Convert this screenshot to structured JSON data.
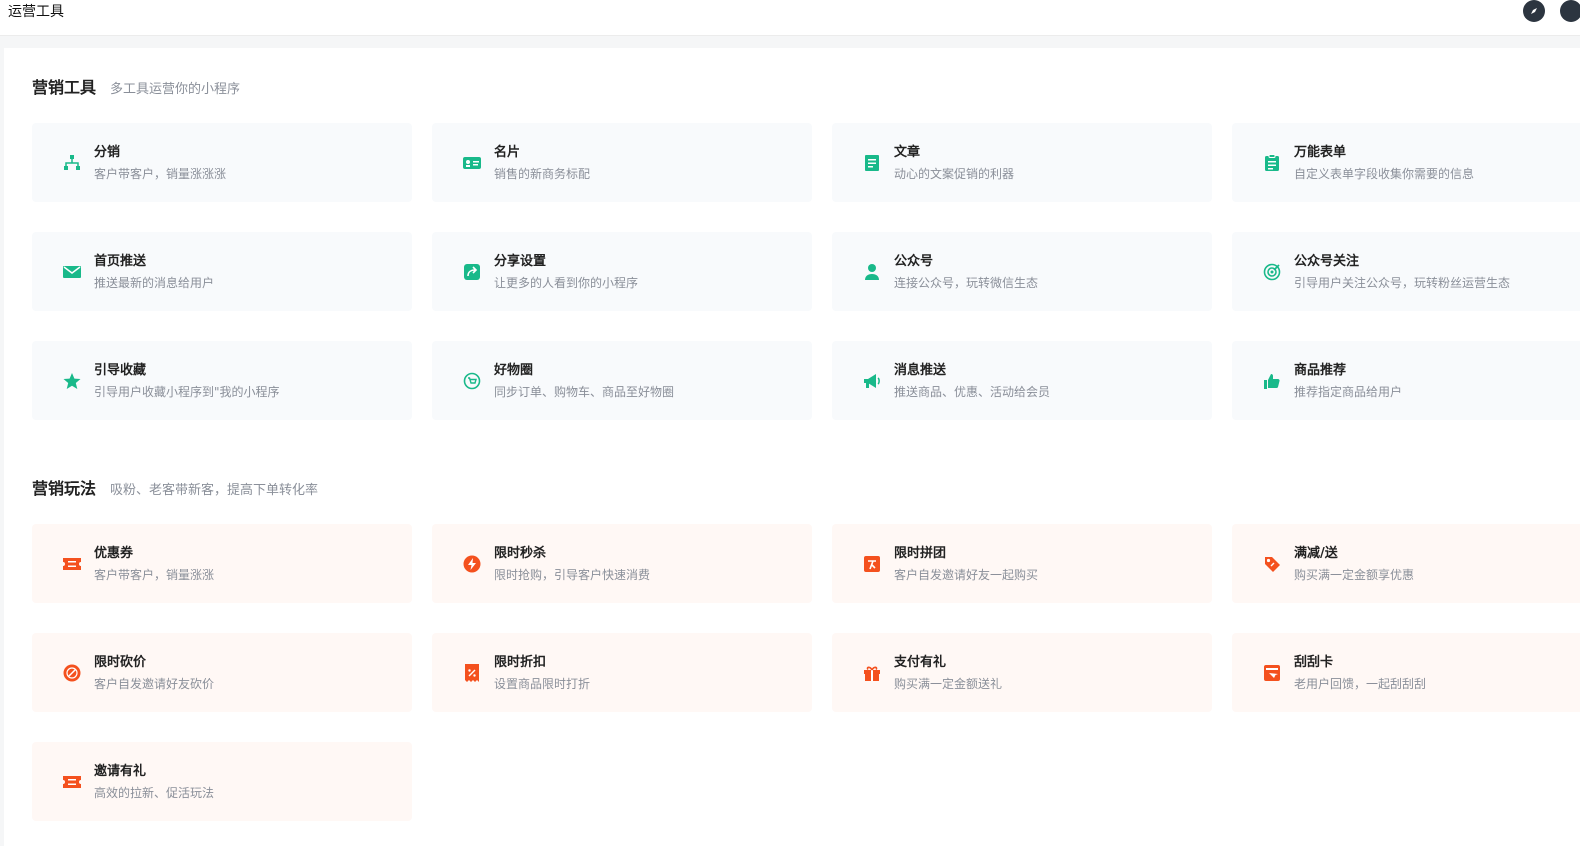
{
  "header": {
    "title": "运营工具"
  },
  "colors": {
    "green": "#19b98a",
    "orange": "#f4511e"
  },
  "tools": {
    "title": "营销工具",
    "subtitle": "多工具运营你的小程序",
    "items": [
      {
        "title": "分销",
        "desc": "客户带客户，销量涨涨涨",
        "icon": "org-chart-icon"
      },
      {
        "title": "名片",
        "desc": "销售的新商务标配",
        "icon": "id-card-icon"
      },
      {
        "title": "文章",
        "desc": "动心的文案促销的利器",
        "icon": "document-icon"
      },
      {
        "title": "万能表单",
        "desc": "自定义表单字段收集你需要的信息",
        "icon": "clipboard-icon"
      },
      {
        "title": "首页推送",
        "desc": "推送最新的消息给用户",
        "icon": "mail-icon"
      },
      {
        "title": "分享设置",
        "desc": "让更多的人看到你的小程序",
        "icon": "share-icon"
      },
      {
        "title": "公众号",
        "desc": "连接公众号，玩转微信生态",
        "icon": "person-icon"
      },
      {
        "title": "公众号关注",
        "desc": "引导用户关注公众号，玩转粉丝运营生态",
        "icon": "target-icon"
      },
      {
        "title": "引导收藏",
        "desc": "引导用户收藏小程序到\"我的小程序",
        "icon": "star-icon"
      },
      {
        "title": "好物圈",
        "desc": "同步订单、购物车、商品至好物圈",
        "icon": "cart-circle-icon"
      },
      {
        "title": "消息推送",
        "desc": "推送商品、优惠、活动给会员",
        "icon": "megaphone-icon"
      },
      {
        "title": "商品推荐",
        "desc": "推荐指定商品给用户",
        "icon": "thumbs-up-icon"
      }
    ]
  },
  "play": {
    "title": "营销玩法",
    "subtitle": "吸粉、老客带新客，提高下单转化率",
    "items": [
      {
        "title": "优惠券",
        "desc": "客户带客户，销量涨涨",
        "icon": "coupon-icon"
      },
      {
        "title": "限时秒杀",
        "desc": "限时抢购，引导客户快速消费",
        "icon": "lightning-icon"
      },
      {
        "title": "限时拼团",
        "desc": "客户自发邀请好友一起购买",
        "icon": "group-buy-icon"
      },
      {
        "title": "满减/送",
        "desc": "购买满一定金额享优惠",
        "icon": "price-tag-icon"
      },
      {
        "title": "限时砍价",
        "desc": "客户自发邀请好友砍价",
        "icon": "bargain-icon"
      },
      {
        "title": "限时折扣",
        "desc": "设置商品限时打折",
        "icon": "discount-icon"
      },
      {
        "title": "支付有礼",
        "desc": "购买满一定金额送礼",
        "icon": "gift-icon"
      },
      {
        "title": "刮刮卡",
        "desc": "老用户回馈，一起刮刮刮",
        "icon": "scratch-card-icon"
      },
      {
        "title": "邀请有礼",
        "desc": "高效的拉新、促活玩法",
        "icon": "invite-ticket-icon"
      }
    ]
  }
}
